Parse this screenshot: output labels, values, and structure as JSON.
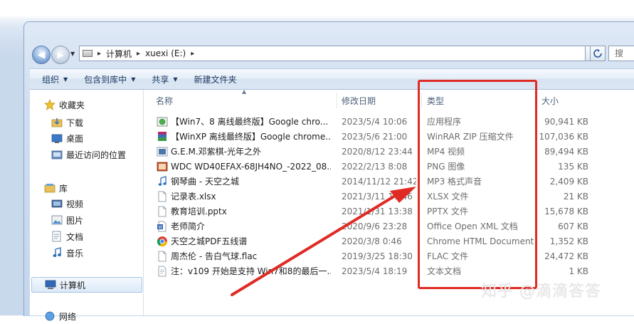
{
  "address": {
    "breadcrumbs": [
      "计算机",
      "xuexi (E:)"
    ],
    "search_placeholder": "搜"
  },
  "toolbar": {
    "organize": "组织",
    "include_in_library": "包含到库中",
    "share": "共享",
    "new_folder": "新建文件夹"
  },
  "sidebar": {
    "favorites": "收藏夹",
    "downloads": "下载",
    "desktop": "桌面",
    "recent": "最近访问的位置",
    "libraries": "库",
    "videos": "视频",
    "pictures": "图片",
    "documents": "文档",
    "music": "音乐",
    "computer": "计算机",
    "network": "网络"
  },
  "columns": {
    "name": "名称",
    "date": "修改日期",
    "type": "类型",
    "size": "大小"
  },
  "files": [
    {
      "name": "【Win7、8 离线最终版】Google chro...",
      "date": "2023/5/4 10:06",
      "type": "应用程序",
      "size": "90,941 KB",
      "icon": "app-icon"
    },
    {
      "name": "【WinXP 离线最终版】Google chrome...",
      "date": "2023/5/6 21:00",
      "type": "WinRAR ZIP 压缩文件",
      "size": "107,036 KB",
      "icon": "winrar-icon"
    },
    {
      "name": "G.E.M.邓紫棋-光年之外",
      "date": "2020/8/12 23:44",
      "type": "MP4 视频",
      "size": "89,494 KB",
      "icon": "video-icon"
    },
    {
      "name": "WDC WD40EFAX-68JH4NO_-2022_08...",
      "date": "2022/2/13 8:08",
      "type": "PNG 图像",
      "size": "135 KB",
      "icon": "image-icon"
    },
    {
      "name": "钢琴曲 - 天空之城",
      "date": "2014/11/12 21:42",
      "type": "MP3 格式声音",
      "size": "2,409 KB",
      "icon": "music-icon"
    },
    {
      "name": "记录表.xlsx",
      "date": "2021/3/11 17:46",
      "type": "XLSX 文件",
      "size": "21 KB",
      "icon": "file-icon"
    },
    {
      "name": "教育培训.pptx",
      "date": "2021/1/31 13:38",
      "type": "PPTX 文件",
      "size": "15,678 KB",
      "icon": "file-icon"
    },
    {
      "name": "老师简介",
      "date": "2020/9/6 23:28",
      "type": "Office Open XML 文档",
      "size": "607 KB",
      "icon": "doc-icon"
    },
    {
      "name": "天空之城PDF五线谱",
      "date": "2020/3/8 0:46",
      "type": "Chrome HTML Document",
      "size": "1,352 KB",
      "icon": "chrome-icon"
    },
    {
      "name": "周杰伦 - 告白气球.flac",
      "date": "2019/3/25 18:30",
      "type": "FLAC 文件",
      "size": "24,472 KB",
      "icon": "file-icon"
    },
    {
      "name": "注：v109 开始是支持 Win7和8的最后一...",
      "date": "2023/5/4 18:19",
      "type": "文本文档",
      "size": "1 KB",
      "icon": "text-icon"
    }
  ],
  "watermark": "知乎 @滴滴答答",
  "colors": {
    "annotation": "#e02a24"
  }
}
